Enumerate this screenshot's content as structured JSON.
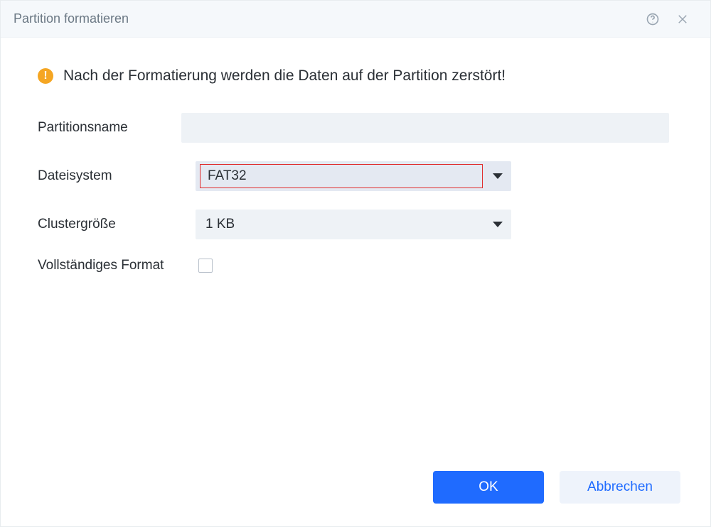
{
  "window": {
    "title": "Partition formatieren"
  },
  "warning": {
    "text": "Nach der Formatierung werden die Daten auf der Partition zerstört!"
  },
  "form": {
    "partition_name_label": "Partitionsname",
    "partition_name_value": "",
    "filesystem_label": "Dateisystem",
    "filesystem_value": "FAT32",
    "cluster_label": "Clustergröße",
    "cluster_value": "1 KB",
    "full_format_label": "Vollständiges Format",
    "full_format_checked": false
  },
  "buttons": {
    "ok": "OK",
    "cancel": "Abbrechen"
  }
}
